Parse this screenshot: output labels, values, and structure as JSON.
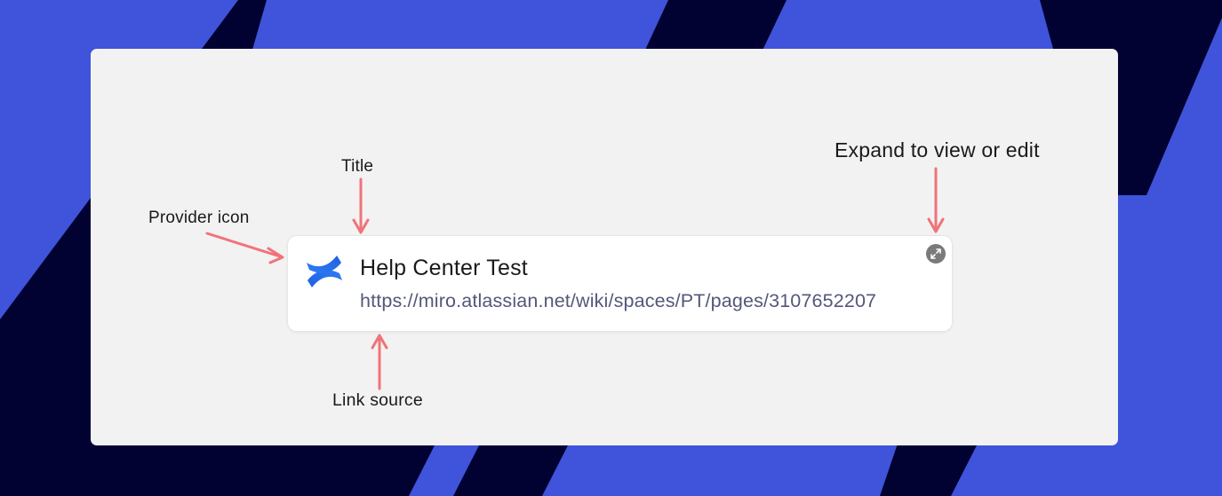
{
  "background": {
    "base_color": "#3f54da",
    "stripe_color": "#020232",
    "panel_color": "#f2f2f2"
  },
  "annotations": {
    "title_label": "Title",
    "provider_icon_label": "Provider icon",
    "expand_label": "Expand to view or edit",
    "link_source_label": "Link source",
    "arrow_color": "#f07379"
  },
  "card": {
    "provider_icon": "confluence-icon",
    "title": "Help Center Test",
    "url": "https://miro.atlassian.net/wiki/spaces/PT/pages/3107652207",
    "expand_icon": "expand-icon"
  }
}
